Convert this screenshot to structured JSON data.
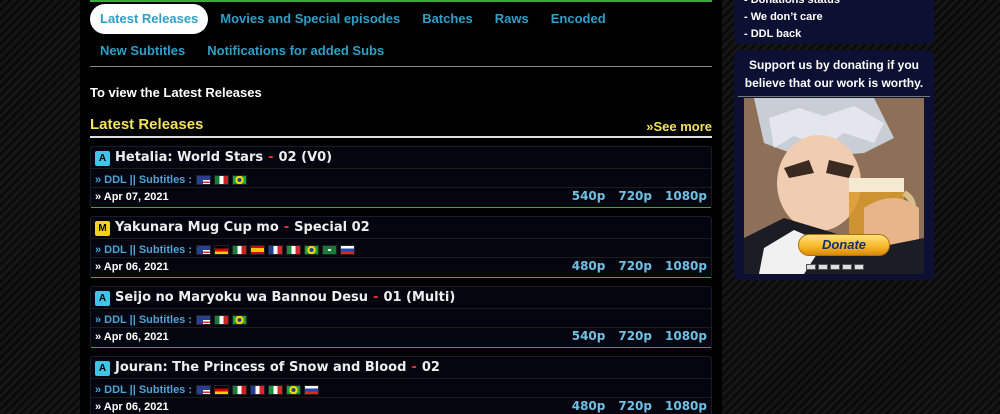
{
  "tabs": [
    {
      "label": "Latest Releases",
      "active": true
    },
    {
      "label": "Movies and Special episodes"
    },
    {
      "label": "Batches"
    },
    {
      "label": "Raws"
    },
    {
      "label": "Encoded"
    },
    {
      "label": "New Subtitles"
    },
    {
      "label": "Notifications for added Subs"
    }
  ],
  "intro": "To view the Latest Releases",
  "section": {
    "title": "Latest Releases",
    "see_more": "»See more"
  },
  "releases": [
    {
      "badge": "A",
      "title": "Hetalia: World Stars",
      "episode": "02 (V0)",
      "ddl": "» DDL || Subtitles :",
      "date": "» Apr 07, 2021",
      "res": [
        "540p",
        "720p",
        "1080p"
      ]
    },
    {
      "badge": "M",
      "title": "Yakunara Mug Cup mo",
      "episode": "Special 02",
      "ddl": "» DDL || Subtitles :",
      "date": "» Apr 06, 2021",
      "res": [
        "480p",
        "720p",
        "1080p"
      ]
    },
    {
      "badge": "A",
      "title": "Seijo no Maryoku wa Bannou Desu",
      "episode": "01 (Multi)",
      "ddl": "» DDL || Subtitles :",
      "date": "» Apr 06, 2021",
      "res": [
        "540p",
        "720p",
        "1080p"
      ]
    },
    {
      "badge": "A",
      "title": "Jouran: The Princess of Snow and Blood",
      "episode": "02",
      "ddl": "» DDL || Subtitles :",
      "date": "» Apr 06, 2021",
      "res": [
        "480p",
        "720p",
        "1080p"
      ]
    }
  ],
  "sidebar": {
    "list": [
      "- Donations status",
      "- We don’t care",
      "- DDL back"
    ],
    "donate_text": "Support us by donating if you believe that our work is worthy.",
    "donate_button": "Donate"
  }
}
